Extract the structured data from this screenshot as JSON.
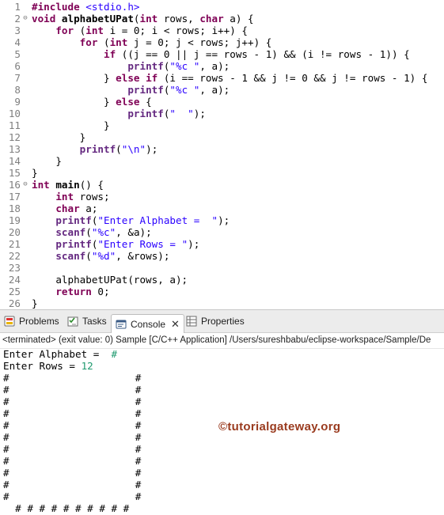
{
  "editor": {
    "lines": [
      {
        "n": "1",
        "fold": "",
        "parts": [
          [
            "pp",
            "#include "
          ],
          [
            "inc",
            "<stdio.h>"
          ]
        ]
      },
      {
        "n": "2",
        "fold": "⊖",
        "parts": [
          [
            "kw",
            "void "
          ],
          [
            "fn",
            "alphabetUPat"
          ],
          [
            "",
            "("
          ],
          [
            "kw",
            "int"
          ],
          [
            "",
            " rows, "
          ],
          [
            "kw",
            "char"
          ],
          [
            "",
            " a) {"
          ]
        ]
      },
      {
        "n": "3",
        "fold": "",
        "parts": [
          [
            "",
            "    "
          ],
          [
            "kw",
            "for"
          ],
          [
            "",
            " ("
          ],
          [
            "kw",
            "int"
          ],
          [
            "",
            " i = 0; i < rows; i++) {"
          ]
        ]
      },
      {
        "n": "4",
        "fold": "",
        "parts": [
          [
            "",
            "        "
          ],
          [
            "kw",
            "for"
          ],
          [
            "",
            " ("
          ],
          [
            "kw",
            "int"
          ],
          [
            "",
            " j = 0; j < rows; j++) {"
          ]
        ]
      },
      {
        "n": "5",
        "fold": "",
        "parts": [
          [
            "",
            "            "
          ],
          [
            "kw",
            "if"
          ],
          [
            "",
            " ((j == 0 || j == rows - 1) && (i != rows - 1)) {"
          ]
        ]
      },
      {
        "n": "6",
        "fold": "",
        "parts": [
          [
            "",
            "                "
          ],
          [
            "fnc",
            "printf"
          ],
          [
            "",
            "("
          ],
          [
            "str",
            "\"%c \""
          ],
          [
            "",
            ", a);"
          ]
        ]
      },
      {
        "n": "7",
        "fold": "",
        "parts": [
          [
            "",
            "            } "
          ],
          [
            "kw",
            "else if"
          ],
          [
            "",
            " (i == rows - 1 && j != 0 && j != rows - 1) {"
          ]
        ]
      },
      {
        "n": "8",
        "fold": "",
        "parts": [
          [
            "",
            "                "
          ],
          [
            "fnc",
            "printf"
          ],
          [
            "",
            "("
          ],
          [
            "str",
            "\"%c \""
          ],
          [
            "",
            ", a);"
          ]
        ]
      },
      {
        "n": "9",
        "fold": "",
        "parts": [
          [
            "",
            "            } "
          ],
          [
            "kw",
            "else"
          ],
          [
            "",
            " {"
          ]
        ]
      },
      {
        "n": "10",
        "fold": "",
        "parts": [
          [
            "",
            "                "
          ],
          [
            "fnc",
            "printf"
          ],
          [
            "",
            "("
          ],
          [
            "str",
            "\"  \""
          ],
          [
            "",
            ");"
          ]
        ]
      },
      {
        "n": "11",
        "fold": "",
        "parts": [
          [
            "",
            "            }"
          ]
        ]
      },
      {
        "n": "12",
        "fold": "",
        "parts": [
          [
            "",
            "        }"
          ]
        ]
      },
      {
        "n": "13",
        "fold": "",
        "parts": [
          [
            "",
            "        "
          ],
          [
            "fnc",
            "printf"
          ],
          [
            "",
            "("
          ],
          [
            "str",
            "\"\\n\""
          ],
          [
            "",
            ");"
          ]
        ]
      },
      {
        "n": "14",
        "fold": "",
        "parts": [
          [
            "",
            "    }"
          ]
        ]
      },
      {
        "n": "15",
        "fold": "",
        "parts": [
          [
            "",
            "}"
          ]
        ]
      },
      {
        "n": "16",
        "fold": "⊖",
        "parts": [
          [
            "kw",
            "int "
          ],
          [
            "fn",
            "main"
          ],
          [
            "",
            "() {"
          ]
        ]
      },
      {
        "n": "17",
        "fold": "",
        "parts": [
          [
            "",
            "    "
          ],
          [
            "kw",
            "int"
          ],
          [
            "",
            " rows;"
          ]
        ]
      },
      {
        "n": "18",
        "fold": "",
        "parts": [
          [
            "",
            "    "
          ],
          [
            "kw",
            "char"
          ],
          [
            "",
            " a;"
          ]
        ]
      },
      {
        "n": "19",
        "fold": "",
        "parts": [
          [
            "",
            "    "
          ],
          [
            "fnc",
            "printf"
          ],
          [
            "",
            "("
          ],
          [
            "str",
            "\"Enter Alphabet =  \""
          ],
          [
            "",
            ");"
          ]
        ]
      },
      {
        "n": "20",
        "fold": "",
        "parts": [
          [
            "",
            "    "
          ],
          [
            "fnc",
            "scanf"
          ],
          [
            "",
            "("
          ],
          [
            "str",
            "\"%c\""
          ],
          [
            "",
            ", &a);"
          ]
        ]
      },
      {
        "n": "21",
        "fold": "",
        "parts": [
          [
            "",
            "    "
          ],
          [
            "fnc",
            "printf"
          ],
          [
            "",
            "("
          ],
          [
            "str",
            "\"Enter Rows = \""
          ],
          [
            "",
            ");"
          ]
        ]
      },
      {
        "n": "22",
        "fold": "",
        "parts": [
          [
            "",
            "    "
          ],
          [
            "fnc",
            "scanf"
          ],
          [
            "",
            "("
          ],
          [
            "str",
            "\"%d\""
          ],
          [
            "",
            ", &rows);"
          ]
        ]
      },
      {
        "n": "23",
        "fold": "",
        "parts": []
      },
      {
        "n": "24",
        "fold": "",
        "parts": [
          [
            "",
            "    alphabetUPat(rows, a);"
          ]
        ]
      },
      {
        "n": "25",
        "fold": "",
        "parts": [
          [
            "",
            "    "
          ],
          [
            "kw",
            "return"
          ],
          [
            "",
            " 0;"
          ]
        ]
      },
      {
        "n": "26",
        "fold": "",
        "parts": [
          [
            "",
            "}"
          ]
        ]
      }
    ]
  },
  "tabs": {
    "problems": "Problems",
    "tasks": "Tasks",
    "console": "Console",
    "close": "✕",
    "properties": "Properties"
  },
  "status_text": "<terminated> (exit value: 0) Sample [C/C++ Application] /Users/sureshbabu/eclipse-workspace/Sample/De",
  "console": {
    "prompt_alphabet": "Enter Alphabet =  ",
    "alphabet_value": "#",
    "prompt_rows": "Enter Rows = ",
    "rows_value": "12",
    "output_lines": [
      "#                     #",
      "#                     #",
      "#                     #",
      "#                     #",
      "#                     #",
      "#                     #",
      "#                     #",
      "#                     #",
      "#                     #",
      "#                     #",
      "#                     #",
      "  # # # # # # # # # #"
    ]
  },
  "watermark": "©tutorialgateway.org",
  "colors": {
    "keyword": "#7f0055",
    "string": "#2a00ff",
    "input": "#1f9a6f",
    "watermark": "#9a3b1f"
  }
}
